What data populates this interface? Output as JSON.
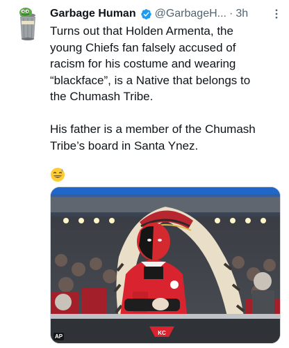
{
  "tweet": {
    "author_name": "Garbage Human",
    "handle": "@GarbageH...",
    "separator": "·",
    "time": "3h",
    "paragraph1": "Turns out that Holden Armenta, the\nyoung Chiefs fan falsely accused of\nracism for his costume and wearing\n“blackface”, is a Native that belongs to\nthe Chumash Tribe.",
    "paragraph2": "His father is a member of the Chumash\nTribe’s board in Santa Ynez.",
    "emoji": "sweat-smile-emoji",
    "media_credit": "AP"
  },
  "icons": {
    "avatar": "oscar-trash-can-avatar",
    "verified": "verified-badge-icon",
    "more": "more-options-icon"
  },
  "colors": {
    "verified_blue": "#1d9bf0",
    "secondary_text": "#536471",
    "primary_text": "#0f1419",
    "chiefs_red": "#d9232e"
  }
}
